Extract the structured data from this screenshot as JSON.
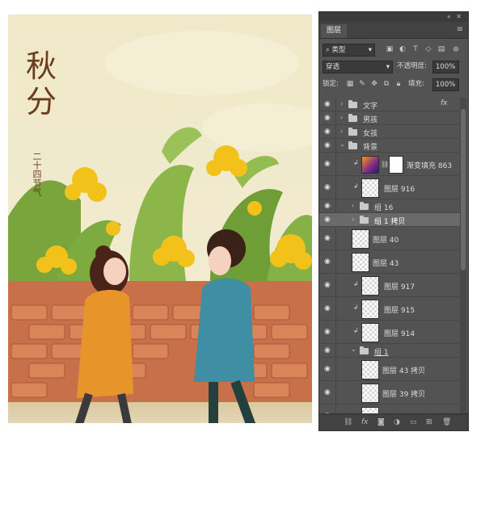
{
  "artwork": {
    "title_line1": "秋",
    "title_line2": "分",
    "subtitle_vertical": "二十四节气"
  },
  "panel": {
    "tab_label": "图层",
    "filter_kind": "类型",
    "blend_mode": "穿透",
    "opacity_label": "不透明度:",
    "opacity_value": "100%",
    "lock_label": "锁定:",
    "fill_label": "填充:",
    "fill_value": "100%",
    "fx_label": "fx"
  },
  "layers": [
    {
      "name": "文字",
      "type": "group",
      "expanded": false,
      "indent": 0
    },
    {
      "name": "男孩",
      "type": "group",
      "expanded": false,
      "indent": 0
    },
    {
      "name": "女孩",
      "type": "group",
      "expanded": false,
      "indent": 0
    },
    {
      "name": "背景",
      "type": "group",
      "expanded": true,
      "indent": 0
    },
    {
      "name": "渐变填充 863",
      "type": "gradient-fill",
      "indent": 1
    },
    {
      "name": "图层 916",
      "type": "layer",
      "indent": 1
    },
    {
      "name": "组 16",
      "type": "group",
      "expanded": false,
      "indent": 1
    },
    {
      "name": "组 1 拷贝",
      "type": "group",
      "expanded": false,
      "indent": 1,
      "selected": true
    },
    {
      "name": "图层 40",
      "type": "layer",
      "indent": 1
    },
    {
      "name": "图层 43",
      "type": "layer",
      "indent": 1
    },
    {
      "name": "图层 917",
      "type": "layer",
      "indent": 1
    },
    {
      "name": "图层 915",
      "type": "layer",
      "indent": 1
    },
    {
      "name": "图层 914",
      "type": "layer",
      "indent": 1
    },
    {
      "name": "组 1",
      "type": "group",
      "expanded": true,
      "indent": 1
    },
    {
      "name": "图层 43 拷贝",
      "type": "layer",
      "indent": 2
    },
    {
      "name": "图层 39 拷贝",
      "type": "layer",
      "indent": 2
    }
  ],
  "colors": {
    "panel_bg": "#535353",
    "selected_row": "#6a6a6a",
    "brick": "#c7704a",
    "title_brown": "#6b3d1e"
  }
}
